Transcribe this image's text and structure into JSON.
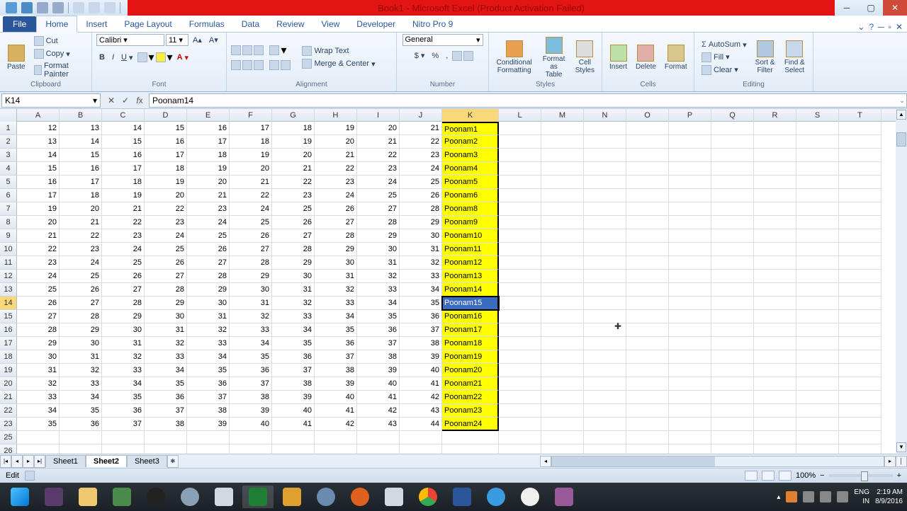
{
  "title": "Book1 - Microsoft Excel (Product Activation Failed)",
  "tabs": {
    "file": "File",
    "home": "Home",
    "insert": "Insert",
    "pagelayout": "Page Layout",
    "formulas": "Formulas",
    "data": "Data",
    "review": "Review",
    "view": "View",
    "developer": "Developer",
    "nitro": "Nitro Pro 9"
  },
  "ribbon": {
    "clipboard": {
      "paste": "Paste",
      "cut": "Cut",
      "copy": "Copy",
      "fmtpainter": "Format Painter",
      "label": "Clipboard"
    },
    "font": {
      "name": "Calibri",
      "size": "11",
      "label": "Font"
    },
    "alignment": {
      "wrap": "Wrap Text",
      "merge": "Merge & Center",
      "label": "Alignment"
    },
    "number": {
      "fmt": "General",
      "label": "Number"
    },
    "styles": {
      "cond": "Conditional\nFormatting",
      "fat": "Format\nas Table",
      "cellst": "Cell\nStyles",
      "label": "Styles"
    },
    "cells": {
      "insert": "Insert",
      "delete": "Delete",
      "format": "Format",
      "label": "Cells"
    },
    "editing": {
      "autosum": "AutoSum",
      "fill": "Fill",
      "clear": "Clear",
      "sort": "Sort &\nFilter",
      "find": "Find &\nSelect",
      "label": "Editing"
    }
  },
  "namebox": "K14",
  "formula": "Poonam14",
  "cols": [
    "A",
    "B",
    "C",
    "D",
    "E",
    "F",
    "G",
    "H",
    "I",
    "J",
    "K",
    "L",
    "M",
    "N",
    "O",
    "P",
    "Q",
    "R",
    "S",
    "T"
  ],
  "chart_data": {
    "type": "table",
    "rows": [
      {
        "n": 1,
        "v": [
          12,
          13,
          14,
          15,
          16,
          17,
          18,
          19,
          20,
          21
        ],
        "k": "Poonam1"
      },
      {
        "n": 2,
        "v": [
          13,
          14,
          15,
          16,
          17,
          18,
          19,
          20,
          21,
          22
        ],
        "k": "Poonam2"
      },
      {
        "n": 3,
        "v": [
          14,
          15,
          16,
          17,
          18,
          19,
          20,
          21,
          22,
          23
        ],
        "k": "Poonam3"
      },
      {
        "n": 4,
        "v": [
          15,
          16,
          17,
          18,
          19,
          20,
          21,
          22,
          23,
          24
        ],
        "k": "Poonam4"
      },
      {
        "n": 5,
        "v": [
          16,
          17,
          18,
          19,
          20,
          21,
          22,
          23,
          24,
          25
        ],
        "k": "Poonam5"
      },
      {
        "n": 6,
        "v": [
          17,
          18,
          19,
          20,
          21,
          22,
          23,
          24,
          25,
          26
        ],
        "k": "Poonam6"
      },
      {
        "n": 7,
        "v": [
          19,
          20,
          21,
          22,
          23,
          24,
          25,
          26,
          27,
          28
        ],
        "k": "Poonam8"
      },
      {
        "n": 8,
        "v": [
          20,
          21,
          22,
          23,
          24,
          25,
          26,
          27,
          28,
          29
        ],
        "k": "Poonam9"
      },
      {
        "n": 9,
        "v": [
          21,
          22,
          23,
          24,
          25,
          26,
          27,
          28,
          29,
          30
        ],
        "k": "Poonam10"
      },
      {
        "n": 10,
        "v": [
          22,
          23,
          24,
          25,
          26,
          27,
          28,
          29,
          30,
          31
        ],
        "k": "Poonam11"
      },
      {
        "n": 11,
        "v": [
          23,
          24,
          25,
          26,
          27,
          28,
          29,
          30,
          31,
          32
        ],
        "k": "Poonam12"
      },
      {
        "n": 12,
        "v": [
          24,
          25,
          26,
          27,
          28,
          29,
          30,
          31,
          32,
          33
        ],
        "k": "Poonam13"
      },
      {
        "n": 13,
        "v": [
          25,
          26,
          27,
          28,
          29,
          30,
          31,
          32,
          33,
          34
        ],
        "k": "Poonam14"
      },
      {
        "n": 14,
        "v": [
          26,
          27,
          28,
          29,
          30,
          31,
          32,
          33,
          34,
          35
        ],
        "k": "Poonam15"
      },
      {
        "n": 15,
        "v": [
          27,
          28,
          29,
          30,
          31,
          32,
          33,
          34,
          35,
          36
        ],
        "k": "Poonam16"
      },
      {
        "n": 16,
        "v": [
          28,
          29,
          30,
          31,
          32,
          33,
          34,
          35,
          36,
          37
        ],
        "k": "Poonam17"
      },
      {
        "n": 17,
        "v": [
          29,
          30,
          31,
          32,
          33,
          34,
          35,
          36,
          37,
          38
        ],
        "k": "Poonam18"
      },
      {
        "n": 18,
        "v": [
          30,
          31,
          32,
          33,
          34,
          35,
          36,
          37,
          38,
          39
        ],
        "k": "Poonam19"
      },
      {
        "n": 19,
        "v": [
          31,
          32,
          33,
          34,
          35,
          36,
          37,
          38,
          39,
          40
        ],
        "k": "Poonam20"
      },
      {
        "n": 20,
        "v": [
          32,
          33,
          34,
          35,
          36,
          37,
          38,
          39,
          40,
          41
        ],
        "k": "Poonam21"
      },
      {
        "n": 21,
        "v": [
          33,
          34,
          35,
          36,
          37,
          38,
          39,
          40,
          41,
          42
        ],
        "k": "Poonam22"
      },
      {
        "n": 22,
        "v": [
          34,
          35,
          36,
          37,
          38,
          39,
          40,
          41,
          42,
          43
        ],
        "k": "Poonam23"
      },
      {
        "n": 23,
        "v": [
          35,
          36,
          37,
          38,
          39,
          40,
          41,
          42,
          43,
          44
        ],
        "k": "Poonam24"
      }
    ],
    "empty_rows": [
      25,
      26
    ],
    "selected_row": 14
  },
  "sheets": {
    "s1": "Sheet1",
    "s2": "Sheet2",
    "s3": "Sheet3"
  },
  "status": {
    "mode": "Edit",
    "zoom": "100%"
  },
  "tray": {
    "lang": "ENG",
    "loc": "IN",
    "time": "2:19 AM",
    "date": "8/9/2016"
  }
}
